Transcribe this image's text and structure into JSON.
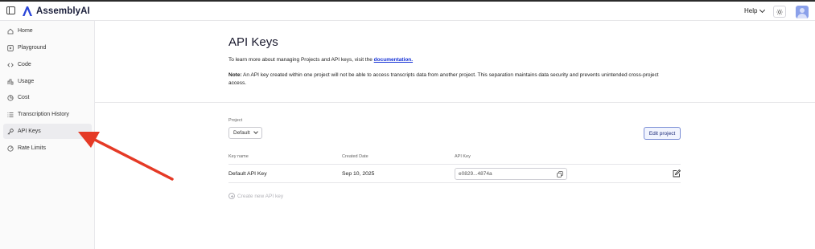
{
  "app": {
    "brand": "AssemblyAI"
  },
  "header": {
    "help_label": "Help"
  },
  "sidebar": {
    "items": [
      {
        "label": "Home",
        "icon": "home-icon"
      },
      {
        "label": "Playground",
        "icon": "play-icon"
      },
      {
        "label": "Code",
        "icon": "code-icon"
      },
      {
        "label": "Usage",
        "icon": "bar-chart-icon"
      },
      {
        "label": "Cost",
        "icon": "pie-chart-icon"
      },
      {
        "label": "Transcription History",
        "icon": "list-icon"
      },
      {
        "label": "API Keys",
        "icon": "key-icon",
        "active": true
      },
      {
        "label": "Rate Limits",
        "icon": "gauge-icon"
      }
    ]
  },
  "main": {
    "title": "API Keys",
    "intro_text": "To learn more about managing Projects and API keys, visit the",
    "intro_link": "documentation.",
    "note_label": "Note:",
    "note_text": " An API key created within one project will not be able to access transcripts data from another project. This separation maintains data security and prevents unintended cross-project access.",
    "project_label": "Project",
    "project_value": "Default",
    "edit_project_label": "Edit project",
    "table": {
      "headers": [
        "Key name",
        "Created Date",
        "API Key"
      ],
      "rows": [
        {
          "name": "Default API Key",
          "created": "Sep 10, 2025",
          "key": "e0829...4874a"
        }
      ]
    },
    "create_label": "Create new API key"
  },
  "colors": {
    "accent": "#1330d6",
    "annotation_arrow": "#e53a26"
  }
}
